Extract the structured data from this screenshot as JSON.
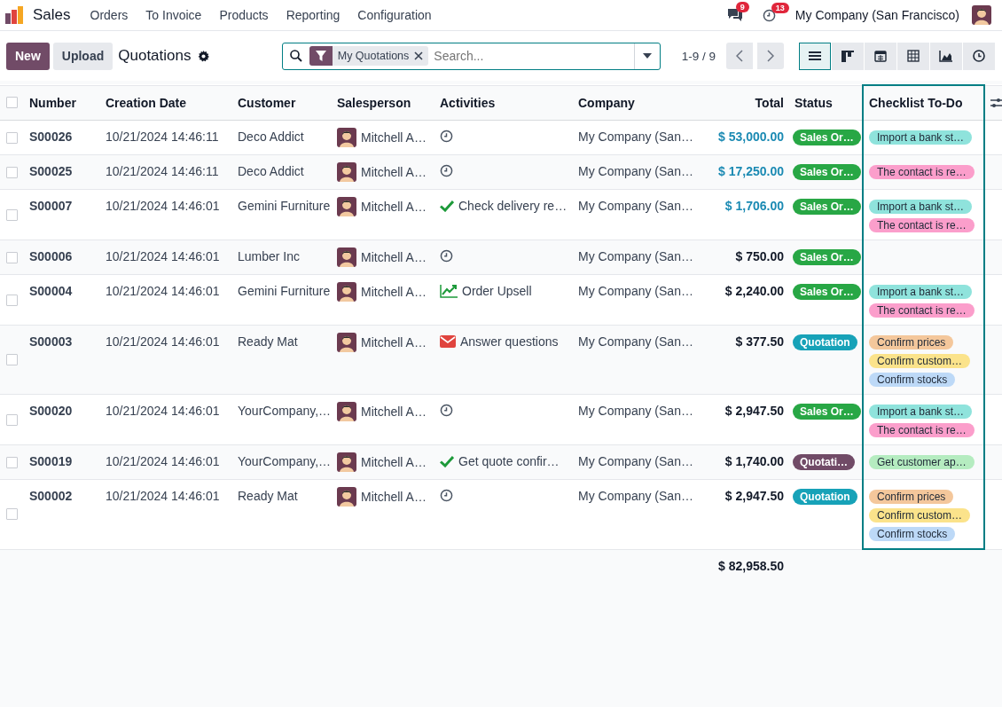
{
  "navbar": {
    "app_name": "Sales",
    "menu": [
      "Orders",
      "To Invoice",
      "Products",
      "Reporting",
      "Configuration"
    ],
    "messages_count": "9",
    "activities_count": "13",
    "company": "My Company (San Francisco)"
  },
  "control_panel": {
    "buttons": [
      {
        "label": "New",
        "kind": "primary"
      },
      {
        "label": "Upload",
        "kind": "secondary"
      }
    ],
    "title": "Quotations",
    "search": {
      "facet": "My Quotations",
      "placeholder": "Search..."
    },
    "pager": "1-9 / 9",
    "views": [
      {
        "kind": "list",
        "selected": true
      },
      {
        "kind": "kanban",
        "selected": false
      },
      {
        "kind": "calendar",
        "selected": false
      },
      {
        "kind": "pivot",
        "selected": false
      },
      {
        "kind": "graph",
        "selected": false
      },
      {
        "kind": "activity",
        "selected": false
      }
    ]
  },
  "table": {
    "select_all_checked": false,
    "columns": [
      {
        "label": "Number",
        "highlighted": false
      },
      {
        "label": "Creation Date",
        "highlighted": false
      },
      {
        "label": "Customer",
        "highlighted": false
      },
      {
        "label": "Salesperson",
        "highlighted": false
      },
      {
        "label": "Activities",
        "highlighted": false
      },
      {
        "label": "Company",
        "highlighted": false
      },
      {
        "label": "Total",
        "highlighted": false
      },
      {
        "label": "Status",
        "highlighted": false
      },
      {
        "label": "Checklist To-Do",
        "highlighted": true
      }
    ],
    "rows": [
      {
        "checked": false,
        "number": "S00026",
        "creation_date": "10/21/2024 14:46:11",
        "customer": "Deco Addict",
        "salesperson": "Mitchell A…",
        "activity": {
          "kind": "clock"
        },
        "company": "My Company (San…",
        "total": "$ 53,000.00",
        "total_highlighted": true,
        "status": {
          "label": "Sales Or…",
          "color": "#28a745"
        },
        "checklist": [
          {
            "label": "Import a bank st…",
            "color": "#8fe3dc"
          }
        ]
      },
      {
        "checked": false,
        "number": "S00025",
        "creation_date": "10/21/2024 14:46:11",
        "customer": "Deco Addict",
        "salesperson": "Mitchell A…",
        "activity": {
          "kind": "clock"
        },
        "company": "My Company (San…",
        "total": "$ 17,250.00",
        "total_highlighted": true,
        "status": {
          "label": "Sales Or…",
          "color": "#28a745"
        },
        "checklist": [
          {
            "label": "The contact is re…",
            "color": "#fb9ecb"
          }
        ]
      },
      {
        "checked": false,
        "number": "S00007",
        "creation_date": "10/21/2024 14:46:01",
        "customer": "Gemini Furniture",
        "salesperson": "Mitchell A…",
        "activity": {
          "kind": "check",
          "text": "Check delivery re…"
        },
        "company": "My Company (San…",
        "total": "$ 1,706.00",
        "total_highlighted": true,
        "status": {
          "label": "Sales Or…",
          "color": "#28a745"
        },
        "checklist": [
          {
            "label": "Import a bank st…",
            "color": "#8fe3dc"
          },
          {
            "label": "The contact is re…",
            "color": "#fb9ecb"
          }
        ]
      },
      {
        "checked": false,
        "number": "S00006",
        "creation_date": "10/21/2024 14:46:01",
        "customer": "Lumber Inc",
        "salesperson": "Mitchell A…",
        "activity": {
          "kind": "clock"
        },
        "company": "My Company (San…",
        "total": "$ 750.00",
        "total_highlighted": false,
        "status": {
          "label": "Sales Or…",
          "color": "#28a745"
        },
        "checklist": []
      },
      {
        "checked": false,
        "number": "S00004",
        "creation_date": "10/21/2024 14:46:01",
        "customer": "Gemini Furniture",
        "salesperson": "Mitchell A…",
        "activity": {
          "kind": "upsell",
          "text": "Order Upsell"
        },
        "company": "My Company (San…",
        "total": "$ 2,240.00",
        "total_highlighted": false,
        "status": {
          "label": "Sales Or…",
          "color": "#28a745"
        },
        "checklist": [
          {
            "label": "Import a bank st…",
            "color": "#8fe3dc"
          },
          {
            "label": "The contact is re…",
            "color": "#fb9ecb"
          }
        ]
      },
      {
        "checked": false,
        "number": "S00003",
        "creation_date": "10/21/2024 14:46:01",
        "customer": "Ready Mat",
        "salesperson": "Mitchell A…",
        "activity": {
          "kind": "email",
          "text": "Answer questions"
        },
        "company": "My Company (San…",
        "total": "$ 377.50",
        "total_highlighted": false,
        "status": {
          "label": "Quotation",
          "color": "#17a2b8"
        },
        "checklist": [
          {
            "label": "Confirm prices",
            "color": "#f4c79b"
          },
          {
            "label": "Confirm custom…",
            "color": "#fbe38b"
          },
          {
            "label": "Confirm stocks",
            "color": "#bdd9f7"
          }
        ]
      },
      {
        "checked": false,
        "number": "S00020",
        "creation_date": "10/21/2024 14:46:01",
        "customer": "YourCompany,…",
        "salesperson": "Mitchell A…",
        "activity": {
          "kind": "clock"
        },
        "company": "My Company (San…",
        "total": "$ 2,947.50",
        "total_highlighted": false,
        "status": {
          "label": "Sales Or…",
          "color": "#28a745"
        },
        "checklist": [
          {
            "label": "Import a bank st…",
            "color": "#8fe3dc"
          },
          {
            "label": "The contact is re…",
            "color": "#fb9ecb"
          }
        ]
      },
      {
        "checked": false,
        "number": "S00019",
        "creation_date": "10/21/2024 14:46:01",
        "customer": "YourCompany,…",
        "salesperson": "Mitchell A…",
        "activity": {
          "kind": "check",
          "text": "Get quote confir…"
        },
        "company": "My Company (San…",
        "total": "$ 1,740.00",
        "total_highlighted": false,
        "status": {
          "label": "Quotati…",
          "color": "#714b67"
        },
        "checklist": [
          {
            "label": "Get customer ap…",
            "color": "#b5ecc0"
          }
        ]
      },
      {
        "checked": false,
        "number": "S00002",
        "creation_date": "10/21/2024 14:46:01",
        "customer": "Ready Mat",
        "salesperson": "Mitchell A…",
        "activity": {
          "kind": "clock"
        },
        "company": "My Company (San…",
        "total": "$ 2,947.50",
        "total_highlighted": false,
        "status": {
          "label": "Quotation",
          "color": "#17a2b8"
        },
        "checklist": [
          {
            "label": "Confirm prices",
            "color": "#f4c79b"
          },
          {
            "label": "Confirm custom…",
            "color": "#fbe38b"
          },
          {
            "label": "Confirm stocks",
            "color": "#bdd9f7"
          }
        ]
      }
    ],
    "footer_total": "$ 82,958.50"
  }
}
